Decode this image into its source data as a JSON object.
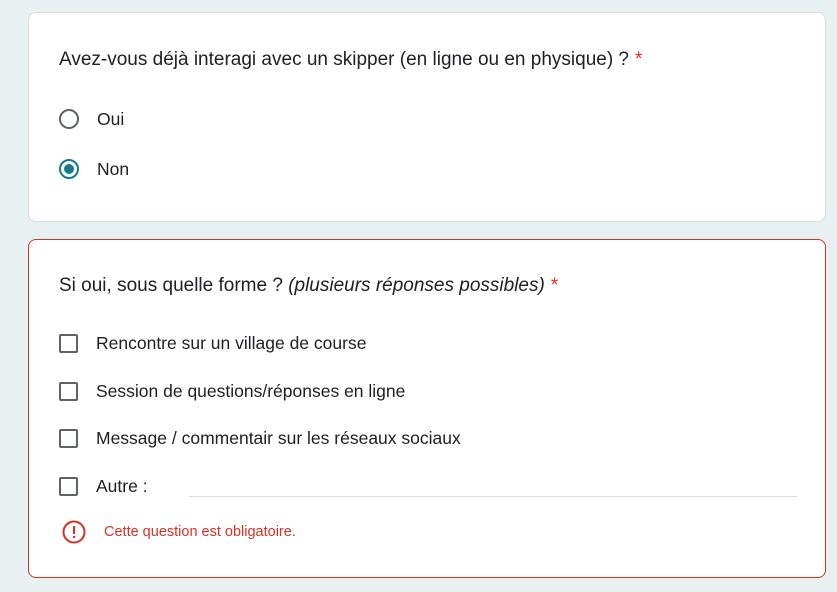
{
  "question1": {
    "title": "Avez-vous déjà interagi avec un skipper (en ligne ou en physique) ?",
    "required_mark": "*",
    "options": [
      {
        "label": "Oui",
        "selected": false
      },
      {
        "label": "Non",
        "selected": true
      }
    ]
  },
  "question2": {
    "title": "Si oui, sous quelle forme ?",
    "hint": "(plusieurs réponses possibles)",
    "required_mark": "*",
    "options": [
      {
        "label": "Rencontre sur un village de course",
        "checked": false
      },
      {
        "label": "Session de questions/réponses en ligne",
        "checked": false
      },
      {
        "label": "Message / commentair sur les réseaux sociaux",
        "checked": false
      },
      {
        "label": "Autre :",
        "checked": false
      }
    ],
    "other_value": "",
    "error": "Cette question est obligatoire."
  },
  "colors": {
    "background": "#e8f0f2",
    "accent": "#167a8b",
    "error": "#d93025",
    "text": "#202124"
  },
  "icons": {
    "error": "error-circle-icon"
  }
}
